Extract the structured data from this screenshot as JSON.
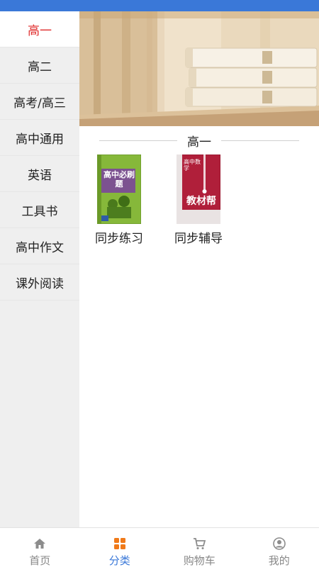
{
  "sidebar": {
    "items": [
      {
        "label": "高一",
        "active": true
      },
      {
        "label": "高二",
        "active": false
      },
      {
        "label": "高考/高三",
        "active": false
      },
      {
        "label": "高中通用",
        "active": false
      },
      {
        "label": "英语",
        "active": false
      },
      {
        "label": "工具书",
        "active": false
      },
      {
        "label": "高中作文",
        "active": false
      },
      {
        "label": "课外阅读",
        "active": false
      }
    ]
  },
  "content": {
    "section_title": "高一",
    "books": [
      {
        "label": "同步练习",
        "cover_text": "高中必刷题"
      },
      {
        "label": "同步辅导",
        "cover_text": "教材帮",
        "cover_subtext": "高中数学"
      }
    ]
  },
  "tabbar": {
    "tabs": [
      {
        "label": "首页",
        "icon": "home-icon"
      },
      {
        "label": "分类",
        "icon": "category-icon",
        "active": true
      },
      {
        "label": "购物车",
        "icon": "cart-icon"
      },
      {
        "label": "我的",
        "icon": "profile-icon"
      }
    ]
  },
  "colors": {
    "accent": "#3a78d8",
    "sidebar_active": "#e02b2b",
    "sidebar_bg": "#efefef"
  }
}
